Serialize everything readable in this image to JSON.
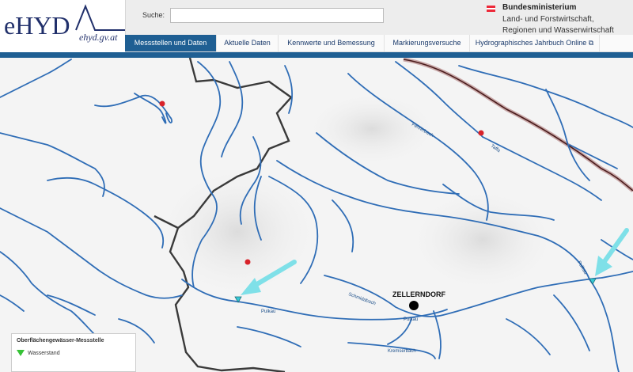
{
  "logo": {
    "name": "eHYD",
    "site": "ehyd.gv.at"
  },
  "search": {
    "label": "Suche:",
    "value": "",
    "placeholder": ""
  },
  "ministry": {
    "title": "Bundesministerium",
    "line1": "Land- und Forstwirtschaft,",
    "line2": "Regionen und Wasserwirtschaft",
    "flag_colors": [
      "#ed2939",
      "#ffffff",
      "#ed2939"
    ]
  },
  "nav": {
    "items": [
      {
        "label": "Messstellen und Daten",
        "active": true
      },
      {
        "label": "Aktuelle Daten",
        "active": false
      },
      {
        "label": "Kennwerte und Bemessung",
        "active": false
      },
      {
        "label": "Markierungsversuche",
        "active": false
      },
      {
        "label": "Hydrographisches Jahrbuch Online ⧉",
        "active": false
      }
    ]
  },
  "map": {
    "town": "ZELLERNDORF",
    "rivers": [
      "Pulkau",
      "Pulkau",
      "Schmidabach",
      "Kremserbach",
      "Taffa",
      "Pulkau",
      "Fehrerbach"
    ],
    "colors": {
      "river": "#2f6db6",
      "border": "#3a3a3a",
      "state_border": "#5a2020",
      "arrow": "#7fe0e8",
      "station_red": "#d8232a",
      "station_cyan": "#37c9d6"
    }
  },
  "legend": {
    "title": "Oberflächengewässer-Messstelle",
    "item": "Wasserstand",
    "icon": "green-triangle-icon"
  }
}
